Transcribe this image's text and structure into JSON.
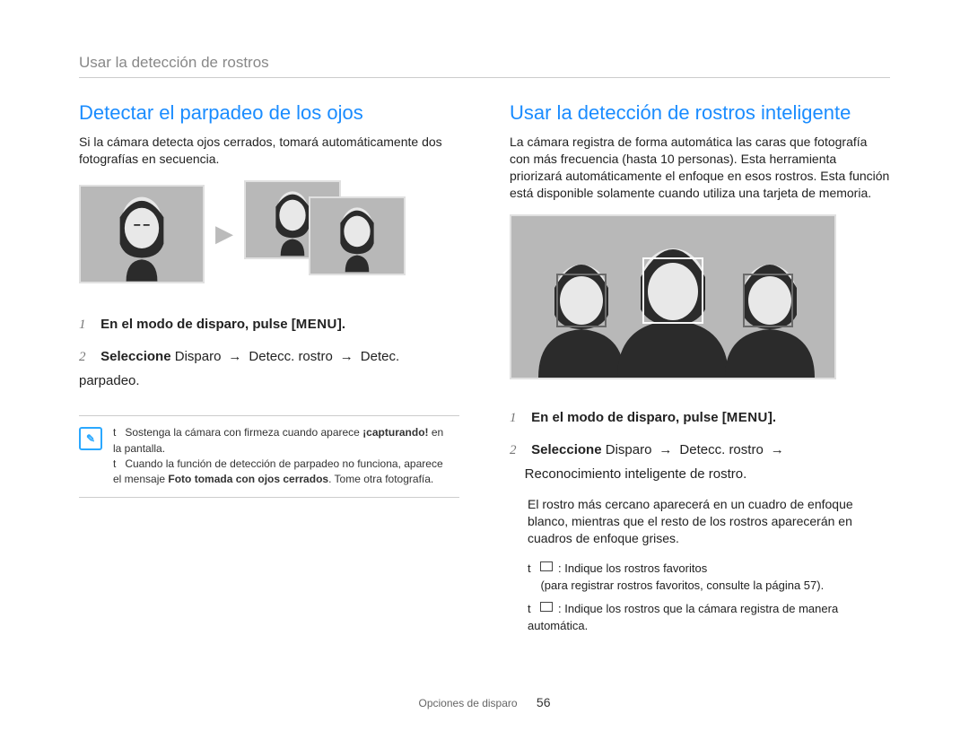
{
  "breadcrumb": "Usar la detección de rostros",
  "left": {
    "title": "Detectar el parpadeo de los ojos",
    "intro": "Si la cámara detecta ojos cerrados, tomará automáticamente dos fotografías en secuencia.",
    "step1_prefix": "En el modo de disparo, pulse [",
    "step1_menu": "MENU",
    "step1_suffix": "].",
    "step2_label": "Seleccione",
    "step2_path_a": "Disparo",
    "step2_path_b": "Detecc. rostro",
    "step2_path_c": "Detec. parpadeo",
    "note_line1_a": "Sostenga la cámara con firmeza cuando aparece",
    "note_line1_b": "¡capturando!",
    "note_line1_c": " en la pantalla.",
    "note_line2_a": "Cuando la función de detección de parpadeo no funciona, aparece el mensaje ",
    "note_line2_b": "Foto tomada con ojos cerrados",
    "note_line2_c": ". Tome otra fotografía."
  },
  "right": {
    "title": "Usar la detección de rostros inteligente",
    "intro": "La cámara registra de forma automática las caras que fotografía con más frecuencia (hasta 10 personas). Esta herramienta priorizará automáticamente el enfoque en esos rostros. Esta función está disponible solamente cuando utiliza una tarjeta de memoria.",
    "step1_prefix": "En el modo de disparo, pulse [",
    "step1_menu": "MENU",
    "step1_suffix": "].",
    "step2_label": "Seleccione",
    "step2_path_a": "Disparo",
    "step2_path_b": "Detecc. rostro",
    "step2_path_c": "Reconocimiento inteligente de rostro",
    "desc": "El rostro más cercano aparecerá en un cuadro de enfoque blanco, mientras que el resto de los rostros aparecerán en cuadros de enfoque grises.",
    "bullet1_a": "Indique los rostros favoritos",
    "bullet1_b": "(para registrar rostros favoritos, consulte la página 57).",
    "bullet2": "Indique los rostros que la cámara registra de manera automática."
  },
  "footer": {
    "section": "Opciones de disparo",
    "page": "56"
  }
}
